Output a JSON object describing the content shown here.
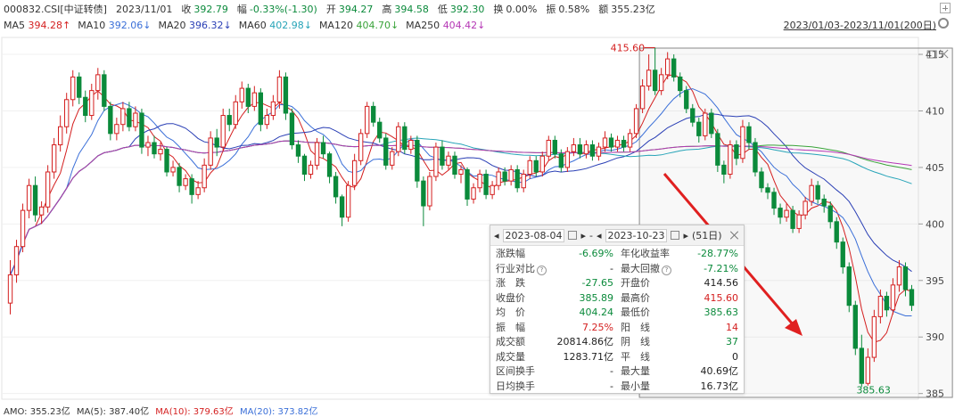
{
  "header": {
    "code": "000832.CSI[中证转债]",
    "date": "2023/11/01",
    "close_label": "收",
    "close_value": "392.79",
    "change_label": "幅",
    "change_value": "-0.33%(-1.30)",
    "open_label": "开",
    "open_value": "394.27",
    "high_label": "高",
    "high_value": "394.58",
    "low_label": "低",
    "low_value": "392.30",
    "turnover_label": "换",
    "turnover_value": "0.00%",
    "amplitude_label": "振",
    "amplitude_value": "0.58%",
    "amount_label": "额",
    "amount_value": "355.23亿"
  },
  "ma_bar": [
    {
      "label": "MA5",
      "value": "394.28↑",
      "color": "#d41f1f"
    },
    {
      "label": "MA10",
      "value": "392.06↓",
      "color": "#3a6fd8"
    },
    {
      "label": "MA20",
      "value": "396.32↓",
      "color": "#2a3fb5"
    },
    {
      "label": "MA60",
      "value": "402.98↓",
      "color": "#27a4b8"
    },
    {
      "label": "MA120",
      "value": "404.70↓",
      "color": "#3aa33a"
    },
    {
      "label": "MA250",
      "value": "404.42↓",
      "color": "#b537b5"
    }
  ],
  "range_label": "2023/01/03-2023/11/01(200日)",
  "footer": {
    "amo_label": "AMO: 355.23亿",
    "ma5_label": "MA(5): 387.40亿",
    "ma10_label": "MA(10): 379.63亿",
    "ma20_label": "MA(20): 373.82亿"
  },
  "stats": {
    "start_date": "2023-08-04",
    "end_date": "2023-10-23",
    "days": "(51日)",
    "rows": [
      {
        "l1": "涨跌幅",
        "v1": "-6.69%",
        "c1": "g",
        "l2": "年化收益率",
        "v2": "-28.77%",
        "c2": "g"
      },
      {
        "l1": "行业对比",
        "q1": true,
        "v1": "-",
        "c1": "n",
        "l2": "最大回撤",
        "q2": true,
        "v2": "-7.21%",
        "c2": "g"
      },
      {
        "l1": "涨　跌",
        "v1": "-27.65",
        "c1": "g",
        "l2": "开盘价",
        "v2": "414.56",
        "c2": "n"
      },
      {
        "l1": "收盘价",
        "v1": "385.89",
        "c1": "g",
        "l2": "最高价",
        "v2": "415.60",
        "c2": "r"
      },
      {
        "l1": "均　价",
        "v1": "404.24",
        "c1": "g",
        "l2": "最低价",
        "v2": "385.63",
        "c2": "g"
      },
      {
        "l1": "振　幅",
        "v1": "7.25%",
        "c1": "r",
        "l2": "阳　线",
        "v2": "14",
        "c2": "r"
      },
      {
        "l1": "成交额",
        "v1": "20814.86亿",
        "c1": "n",
        "l2": "阴　线",
        "v2": "37",
        "c2": "g"
      },
      {
        "l1": "成交量",
        "v1": "1283.71亿",
        "c1": "n",
        "l2": "平　线",
        "v2": "0",
        "c2": "n"
      },
      {
        "l1": "区间换手",
        "v1": "-",
        "c1": "n",
        "l2": "最大量",
        "v2": "40.69亿",
        "c2": "n"
      },
      {
        "l1": "日均换手",
        "v1": "-",
        "c1": "n",
        "l2": "最小量",
        "v2": "16.73亿",
        "c2": "n"
      }
    ]
  },
  "chart_data": {
    "type": "candlestick",
    "ylim": [
      384.5,
      416.5
    ],
    "y_ticks": [
      385,
      390,
      395,
      400,
      405,
      410,
      415
    ],
    "high_label": "415.60",
    "low_label": "385.63",
    "up_color": "#d41f1f",
    "down_color": "#0b8a3b",
    "candles": [
      [
        393.0,
        395.5,
        392.0,
        396.8
      ],
      [
        395.5,
        398.0,
        394.8,
        398.6
      ],
      [
        398.0,
        401.2,
        397.5,
        401.8
      ],
      [
        401.2,
        403.4,
        400.5,
        404.0
      ],
      [
        403.4,
        400.8,
        400.2,
        404.2
      ],
      [
        400.8,
        401.5,
        400.0,
        402.0
      ],
      [
        401.5,
        404.6,
        401.0,
        405.2
      ],
      [
        404.6,
        407.0,
        404.0,
        407.6
      ],
      [
        407.0,
        408.6,
        406.4,
        409.6
      ],
      [
        408.6,
        411.0,
        408.0,
        411.6
      ],
      [
        411.0,
        413.0,
        410.4,
        413.6
      ],
      [
        413.0,
        411.2,
        410.6,
        413.4
      ],
      [
        411.2,
        409.6,
        409.0,
        411.8
      ],
      [
        409.6,
        411.8,
        409.2,
        412.4
      ],
      [
        411.8,
        413.2,
        411.0,
        413.8
      ],
      [
        413.2,
        410.4,
        410.0,
        413.6
      ],
      [
        410.4,
        408.0,
        407.4,
        410.8
      ],
      [
        408.0,
        408.8,
        407.4,
        409.4
      ],
      [
        408.8,
        410.2,
        408.2,
        410.8
      ],
      [
        410.2,
        408.6,
        408.2,
        410.8
      ],
      [
        408.6,
        409.8,
        408.2,
        410.4
      ],
      [
        409.8,
        406.8,
        406.2,
        410.2
      ],
      [
        406.8,
        407.2,
        406.0,
        407.8
      ],
      [
        407.2,
        406.2,
        405.8,
        407.8
      ],
      [
        406.2,
        406.6,
        405.6,
        407.2
      ],
      [
        406.6,
        404.6,
        404.2,
        406.8
      ],
      [
        404.6,
        405.0,
        404.2,
        405.6
      ],
      [
        405.0,
        403.4,
        402.8,
        405.4
      ],
      [
        403.4,
        404.0,
        403.0,
        404.4
      ],
      [
        404.0,
        402.6,
        401.8,
        404.4
      ],
      [
        402.6,
        403.2,
        402.2,
        403.8
      ],
      [
        403.2,
        405.2,
        402.8,
        405.8
      ],
      [
        405.2,
        407.6,
        404.8,
        408.2
      ],
      [
        407.6,
        406.8,
        406.0,
        408.4
      ],
      [
        406.8,
        409.6,
        406.4,
        410.2
      ],
      [
        409.6,
        408.8,
        408.2,
        410.2
      ],
      [
        408.8,
        410.8,
        408.4,
        411.4
      ],
      [
        410.8,
        412.0,
        410.2,
        412.6
      ],
      [
        412.0,
        410.4,
        409.8,
        412.4
      ],
      [
        410.4,
        411.6,
        410.0,
        412.2
      ],
      [
        411.6,
        408.8,
        408.2,
        412.0
      ],
      [
        408.8,
        409.6,
        408.4,
        410.2
      ],
      [
        409.6,
        410.8,
        409.2,
        411.4
      ],
      [
        410.8,
        413.0,
        410.2,
        413.6
      ],
      [
        413.0,
        409.8,
        409.2,
        413.4
      ],
      [
        409.8,
        407.0,
        406.6,
        410.2
      ],
      [
        407.0,
        406.0,
        405.4,
        407.4
      ],
      [
        406.0,
        404.4,
        403.8,
        406.2
      ],
      [
        404.4,
        405.2,
        404.0,
        405.6
      ],
      [
        405.2,
        407.2,
        404.8,
        407.6
      ],
      [
        407.2,
        406.2,
        405.8,
        407.8
      ],
      [
        406.2,
        404.2,
        403.6,
        406.4
      ],
      [
        404.2,
        402.4,
        401.8,
        404.6
      ],
      [
        402.4,
        400.6,
        399.8,
        402.6
      ],
      [
        400.6,
        403.4,
        400.2,
        403.8
      ],
      [
        403.4,
        405.6,
        403.0,
        406.2
      ],
      [
        405.6,
        408.0,
        405.2,
        408.4
      ],
      [
        408.0,
        410.4,
        407.6,
        410.8
      ],
      [
        410.4,
        409.0,
        408.6,
        410.8
      ],
      [
        409.0,
        407.6,
        407.2,
        409.4
      ],
      [
        407.6,
        405.2,
        404.8,
        408.0
      ],
      [
        405.2,
        406.4,
        404.8,
        406.8
      ],
      [
        406.4,
        408.6,
        406.0,
        409.0
      ],
      [
        408.6,
        406.6,
        406.2,
        409.0
      ],
      [
        406.6,
        407.4,
        406.2,
        407.8
      ],
      [
        407.4,
        403.8,
        403.2,
        407.8
      ],
      [
        403.8,
        401.6,
        399.8,
        404.2
      ],
      [
        401.6,
        404.2,
        401.2,
        404.6
      ],
      [
        404.2,
        406.8,
        403.8,
        407.2
      ],
      [
        406.8,
        405.2,
        404.8,
        407.4
      ],
      [
        405.2,
        406.0,
        404.8,
        406.4
      ],
      [
        406.0,
        404.4,
        404.0,
        406.4
      ],
      [
        404.4,
        404.8,
        403.6,
        405.2
      ],
      [
        404.8,
        402.2,
        401.6,
        405.0
      ],
      [
        402.2,
        403.2,
        401.8,
        403.6
      ],
      [
        403.2,
        404.4,
        402.8,
        404.8
      ],
      [
        404.4,
        402.6,
        402.2,
        404.8
      ],
      [
        402.6,
        403.4,
        402.2,
        403.8
      ],
      [
        403.4,
        404.6,
        403.0,
        405.0
      ],
      [
        404.6,
        403.8,
        403.4,
        405.0
      ],
      [
        403.8,
        404.8,
        403.4,
        405.2
      ],
      [
        404.8,
        403.2,
        402.8,
        405.2
      ],
      [
        403.2,
        404.4,
        402.8,
        404.8
      ],
      [
        404.4,
        405.6,
        404.0,
        406.0
      ],
      [
        405.6,
        404.6,
        404.2,
        406.0
      ],
      [
        404.6,
        406.0,
        404.2,
        406.4
      ],
      [
        406.0,
        407.4,
        405.6,
        407.8
      ],
      [
        407.4,
        406.2,
        405.8,
        407.8
      ],
      [
        406.2,
        405.0,
        404.6,
        406.6
      ],
      [
        405.0,
        406.4,
        404.6,
        406.8
      ],
      [
        406.4,
        407.0,
        406.0,
        407.6
      ],
      [
        407.0,
        406.2,
        405.8,
        407.6
      ],
      [
        406.2,
        407.0,
        405.8,
        407.4
      ],
      [
        407.0,
        406.0,
        405.6,
        407.4
      ],
      [
        406.0,
        406.8,
        405.6,
        407.2
      ],
      [
        406.8,
        407.6,
        406.4,
        408.2
      ],
      [
        407.6,
        406.8,
        406.4,
        408.0
      ],
      [
        406.8,
        407.4,
        406.4,
        407.8
      ],
      [
        407.4,
        406.8,
        406.4,
        407.8
      ],
      [
        406.8,
        408.0,
        406.4,
        408.4
      ],
      [
        408.0,
        410.2,
        407.6,
        410.6
      ],
      [
        410.2,
        412.2,
        409.8,
        412.8
      ],
      [
        412.2,
        413.6,
        411.8,
        415.0
      ],
      [
        413.6,
        411.8,
        411.4,
        415.6
      ],
      [
        411.8,
        413.2,
        411.4,
        413.8
      ],
      [
        413.2,
        414.6,
        412.8,
        415.2
      ],
      [
        414.6,
        413.0,
        412.6,
        415.0
      ],
      [
        413.0,
        411.8,
        411.2,
        413.4
      ],
      [
        411.8,
        410.2,
        409.8,
        412.2
      ],
      [
        410.2,
        409.0,
        408.6,
        410.6
      ],
      [
        409.0,
        407.8,
        407.2,
        409.4
      ],
      [
        407.8,
        409.8,
        407.4,
        410.2
      ],
      [
        409.8,
        408.0,
        407.6,
        410.2
      ],
      [
        408.0,
        405.2,
        404.6,
        408.4
      ],
      [
        405.2,
        404.4,
        403.6,
        405.6
      ],
      [
        404.4,
        407.0,
        404.0,
        407.4
      ],
      [
        407.0,
        405.8,
        405.2,
        407.4
      ],
      [
        405.8,
        408.6,
        405.4,
        409.2
      ],
      [
        408.6,
        407.2,
        406.6,
        409.0
      ],
      [
        407.2,
        404.6,
        404.2,
        407.6
      ],
      [
        404.6,
        403.2,
        402.8,
        405.0
      ],
      [
        403.2,
        402.8,
        402.2,
        403.6
      ],
      [
        402.8,
        401.4,
        400.8,
        403.2
      ],
      [
        401.4,
        400.6,
        400.0,
        401.8
      ],
      [
        400.6,
        401.2,
        400.2,
        401.8
      ],
      [
        401.2,
        399.6,
        399.2,
        401.6
      ],
      [
        399.6,
        400.8,
        399.2,
        401.2
      ],
      [
        400.8,
        402.0,
        400.4,
        402.4
      ],
      [
        402.0,
        403.4,
        401.6,
        404.0
      ],
      [
        403.4,
        402.2,
        401.8,
        403.8
      ],
      [
        402.2,
        401.6,
        401.0,
        402.6
      ],
      [
        401.6,
        400.2,
        399.6,
        402.0
      ],
      [
        400.2,
        398.4,
        397.8,
        400.6
      ],
      [
        398.4,
        396.2,
        395.6,
        398.8
      ],
      [
        396.2,
        392.8,
        392.2,
        396.6
      ],
      [
        392.8,
        389.0,
        388.4,
        393.2
      ],
      [
        389.0,
        385.9,
        385.6,
        390.2
      ],
      [
        385.9,
        388.2,
        385.7,
        389.0
      ],
      [
        388.2,
        391.8,
        387.8,
        392.4
      ],
      [
        391.8,
        393.6,
        391.2,
        394.2
      ],
      [
        393.6,
        392.4,
        391.8,
        394.0
      ],
      [
        392.4,
        394.6,
        392.0,
        395.2
      ],
      [
        394.6,
        396.2,
        394.0,
        396.8
      ],
      [
        396.2,
        394.2,
        393.6,
        396.6
      ],
      [
        394.2,
        392.8,
        392.3,
        394.6
      ]
    ],
    "ma_lines": [
      {
        "name": "MA5",
        "color": "#d41f1f"
      },
      {
        "name": "MA10",
        "color": "#3a6fd8"
      },
      {
        "name": "MA20",
        "color": "#2a3fb5"
      },
      {
        "name": "MA60",
        "color": "#27a4b8"
      },
      {
        "name": "MA120",
        "color": "#3aa33a"
      },
      {
        "name": "MA250",
        "color": "#b537b5"
      }
    ]
  }
}
